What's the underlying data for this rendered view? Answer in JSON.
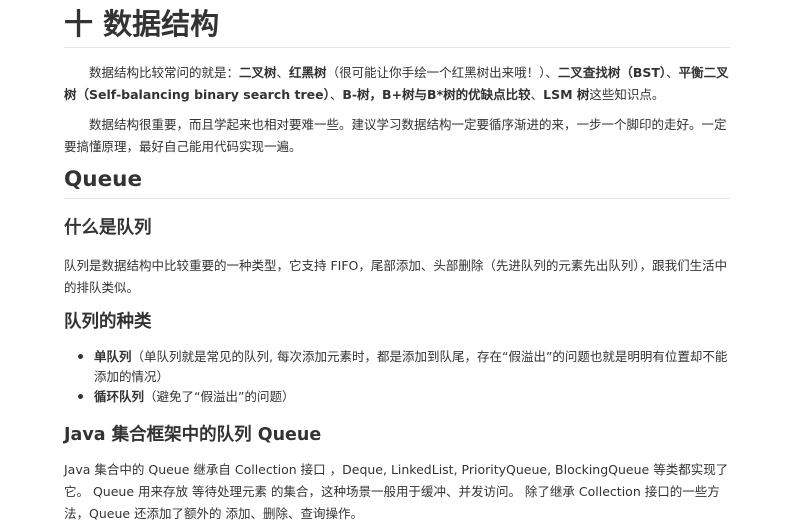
{
  "title": "十 数据结构",
  "intro1": {
    "s1": "数据结构比较常问的就是：",
    "b1": "二叉树",
    "s2": "、",
    "b2": "红黑树",
    "s3": "（很可能让你手绘一个红黑树出来哦！）、",
    "b3": "二叉查找树（BST）",
    "s4": "、",
    "b4": "平衡二叉树（Self-balancing binary search tree）",
    "s5": "、",
    "b5": "B-树，B+树与B*树的优缺点比较",
    "s6": "、",
    "b6": "LSM 树",
    "s7": "这些知识点。"
  },
  "intro2": "数据结构很重要，而且学起来也相对要难一些。建议学习数据结构一定要循序渐进的来，一步一个脚印的走好。一定要搞懂原理，最好自己能用代码实现一遍。",
  "queue": {
    "heading": "Queue",
    "what_heading": "什么是队列",
    "what_text": "队列是数据结构中比较重要的一种类型，它支持 FIFO，尾部添加、头部删除（先进队列的元素先出队列），跟我们生活中的排队类似。",
    "types_heading": "队列的种类",
    "types": [
      {
        "name": "单队列",
        "desc": "（单队列就是常见的队列, 每次添加元素时，都是添加到队尾，存在“假溢出”的问题也就是明明有位置却不能添加的情况）"
      },
      {
        "name": "循环队列",
        "desc": "（避免了“假溢出”的问题）"
      }
    ],
    "java_heading": "Java 集合框架中的队列 Queue",
    "java_text": "Java 集合中的 Queue 继承自 Collection 接口 ，Deque, LinkedList, PriorityQueue, BlockingQueue 等类都实现了它。 Queue 用来存放 等待处理元素 的集合，这种场景一般用于缓冲、并发访问。 除了继承 Collection 接口的一些方法，Queue 还添加了额外的 添加、删除、查询操作。"
  }
}
